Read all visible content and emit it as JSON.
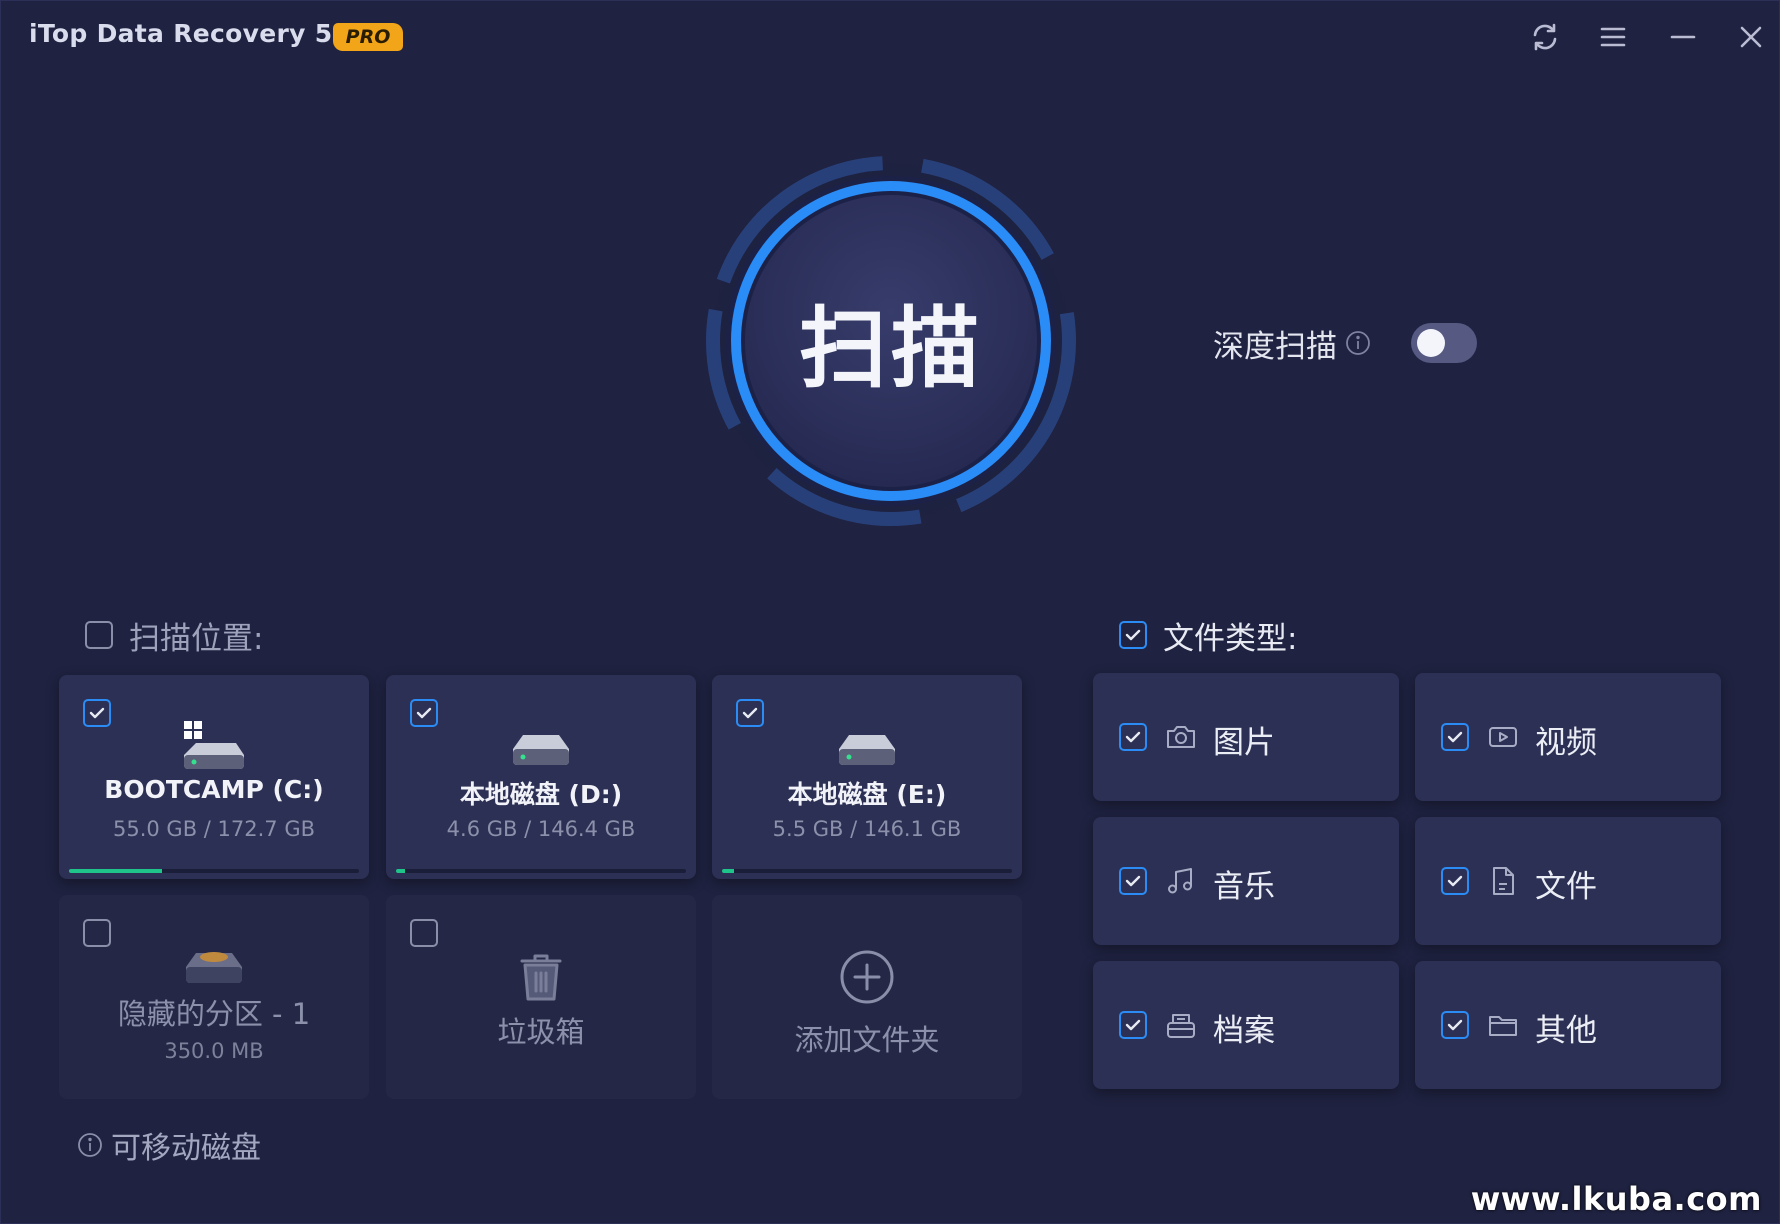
{
  "titlebar": {
    "app_title": "iTop Data Recovery 5.3",
    "badge": "PRO"
  },
  "scan": {
    "label": "扫描",
    "deep_scan_label": "深度扫描",
    "deep_scan_enabled": false
  },
  "locations": {
    "label": "扫描位置:",
    "checked": false,
    "drives": [
      {
        "name": "BOOTCAMP (C:)",
        "size": "55.0 GB / 172.7 GB",
        "checked": true,
        "usage": 0.32,
        "icon": "windows-drive-icon"
      },
      {
        "name": "本地磁盘 (D:)",
        "size": "4.6 GB / 146.4 GB",
        "checked": true,
        "usage": 0.03,
        "icon": "hard-drive-icon"
      },
      {
        "name": "本地磁盘 (E:)",
        "size": "5.5 GB / 146.1 GB",
        "checked": true,
        "usage": 0.04,
        "icon": "hard-drive-icon"
      }
    ],
    "hidden_partition": {
      "name": "隐藏的分区 - 1",
      "size": "350.0 MB",
      "checked": false
    },
    "recycle_bin": {
      "name": "垃圾箱",
      "checked": false
    },
    "add_folder": {
      "name": "添加文件夹"
    },
    "removable_label": "可移动磁盘"
  },
  "file_types": {
    "label": "文件类型:",
    "checked": true,
    "items": [
      {
        "label": "图片",
        "icon": "camera-icon",
        "checked": true
      },
      {
        "label": "视频",
        "icon": "video-icon",
        "checked": true
      },
      {
        "label": "音乐",
        "icon": "music-icon",
        "checked": true
      },
      {
        "label": "文件",
        "icon": "document-icon",
        "checked": true
      },
      {
        "label": "档案",
        "icon": "archive-icon",
        "checked": true
      },
      {
        "label": "其他",
        "icon": "folder-icon",
        "checked": true
      }
    ]
  },
  "watermark": "www.lkuba.com",
  "colors": {
    "background": "#1f2240",
    "card": "#2c3054",
    "accent": "#2b8cf5",
    "usage_bar": "#1ec489",
    "pro_badge": "#f3a51a"
  }
}
